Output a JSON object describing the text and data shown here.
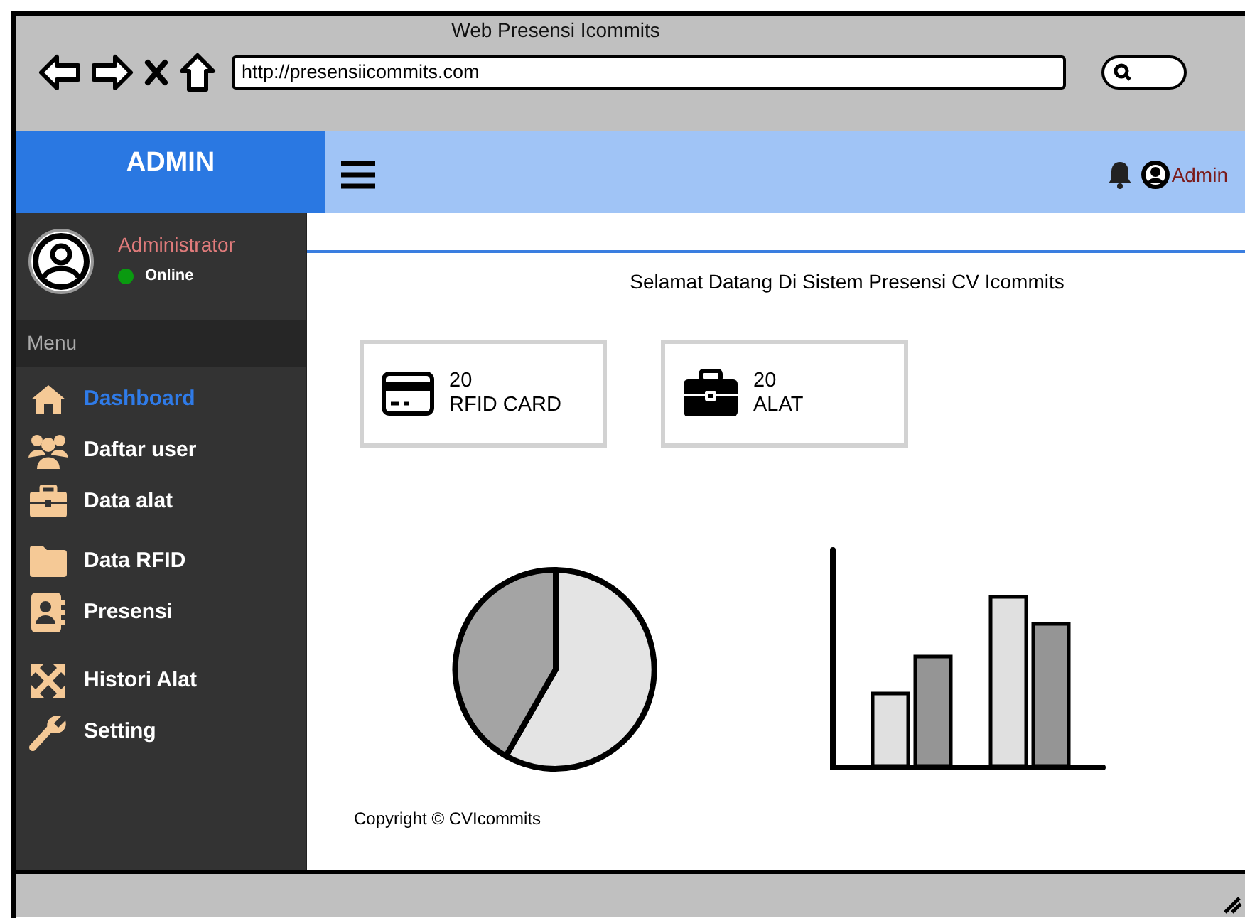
{
  "window": {
    "title": "Web Presensi Icommits",
    "url": "http://presensiicommits.com"
  },
  "header": {
    "brand": "ADMIN",
    "user": "Admin"
  },
  "sidebar": {
    "user": {
      "name": "Administrator",
      "status": "Online",
      "online": true
    },
    "section": "Menu",
    "items": [
      {
        "label": "Dashboard",
        "selected": true
      },
      {
        "label": "Daftar user",
        "selected": false
      },
      {
        "label": "Data alat",
        "selected": false
      },
      {
        "label": "Data RFID",
        "selected": false
      },
      {
        "label": "Presensi",
        "selected": false
      },
      {
        "label": "Histori Alat",
        "selected": false
      },
      {
        "label": "Setting",
        "selected": false
      }
    ]
  },
  "content": {
    "welcome": "Selamat Datang Di Sistem Presensi CV Icommits",
    "cards": [
      {
        "value": "20",
        "label": "RFID CARD"
      },
      {
        "value": "20",
        "label": "ALAT"
      }
    ],
    "copyright": "Copyright © CVIcommits"
  }
}
